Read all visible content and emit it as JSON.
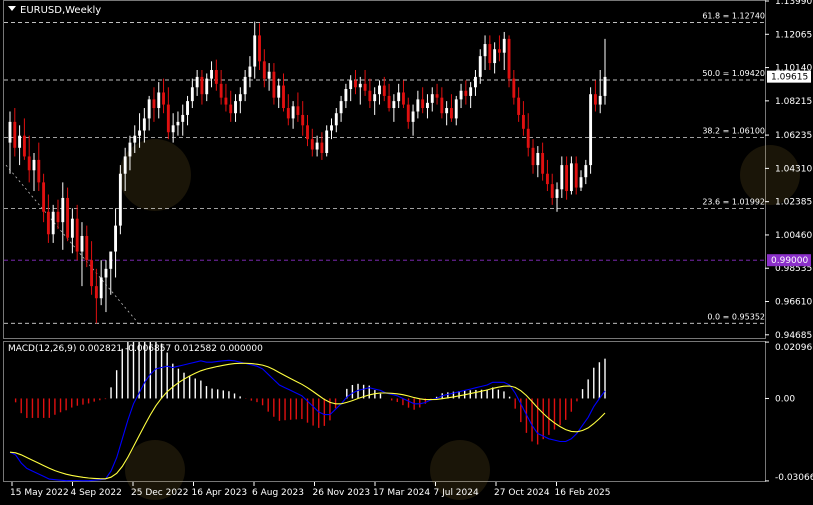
{
  "header": {
    "symbol_label": "EURUSD,Weekly",
    "macd_label": "MACD(12,26,9) 0.002821 -0.006857 0.012582 0.000000"
  },
  "colors": {
    "background": "#000000",
    "bull_candle": "#ffffff",
    "bear_candle": "#e01010",
    "fib_line": "#ffffff",
    "parity_line": "#8b2fc9",
    "macd_line": "#0000ff",
    "signal_line": "#ffff40",
    "hist_positive": "#ffffff",
    "hist_negative": "#e01010",
    "current_price_bg": "#ffffff",
    "parity_label_bg": "#8b2fc9",
    "axis_text": "#ffffff"
  },
  "chart_data": [
    {
      "type": "candlestick",
      "title": "EURUSD,Weekly",
      "ylim": [
        0.945,
        1.1399
      ],
      "y_ticks": [
        "1.13990",
        "1.12065",
        "1.10140",
        "1.08215",
        "1.06235",
        "1.04310",
        "1.02385",
        "1.00460",
        "0.98535",
        "0.96610",
        "0.94685"
      ],
      "x_ticks": [
        "15 May 2022",
        "4 Sep 2022",
        "25 Dec 2022",
        "16 Apr 2023",
        "6 Aug 2023",
        "26 Nov 2023",
        "17 Mar 2024",
        "7 Jul 2024",
        "27 Oct 2024",
        "16 Feb 2025"
      ],
      "current_price": "1.09615",
      "parity_label": "0.99000",
      "fib_levels": [
        {
          "label": "61.8 = 1.12740",
          "value": 1.1274
        },
        {
          "label": "50.0 = 1.09420",
          "value": 1.0942
        },
        {
          "label": "38.2 = 1.06100",
          "value": 1.061
        },
        {
          "label": "23.6 = 1.01992",
          "value": 1.01992
        },
        {
          "label": "0.0 = 0.95352",
          "value": 0.95352
        }
      ],
      "swing_line": {
        "from": 1.045,
        "to": 0.9535
      },
      "candles": [
        [
          1.058,
          1.076,
          1.04,
          1.07
        ],
        [
          1.07,
          1.078,
          1.05,
          1.055
        ],
        [
          1.055,
          1.068,
          1.045,
          1.062
        ],
        [
          1.062,
          1.072,
          1.048,
          1.05
        ],
        [
          1.05,
          1.062,
          1.035,
          1.042
        ],
        [
          1.042,
          1.052,
          1.03,
          1.048
        ],
        [
          1.048,
          1.058,
          1.03,
          1.035
        ],
        [
          1.035,
          1.04,
          1.012,
          1.018
        ],
        [
          1.018,
          1.028,
          1.0,
          1.005
        ],
        [
          1.005,
          1.022,
          1.0,
          1.018
        ],
        [
          1.018,
          1.025,
          1.008,
          1.012
        ],
        [
          1.012,
          1.035,
          0.996,
          1.026
        ],
        [
          1.026,
          1.032,
          1.001,
          1.003
        ],
        [
          1.003,
          1.02,
          0.994,
          1.014
        ],
        [
          1.014,
          1.022,
          0.99,
          0.995
        ],
        [
          0.995,
          1.012,
          0.975,
          1.004
        ],
        [
          1.004,
          1.01,
          0.986,
          0.99
        ],
        [
          0.99,
          1.001,
          0.97,
          0.975
        ],
        [
          0.975,
          0.985,
          0.9535,
          0.968
        ],
        [
          0.968,
          0.99,
          0.964,
          0.98
        ],
        [
          0.98,
          0.99,
          0.96,
          0.985
        ],
        [
          0.985,
          0.995,
          0.97,
          0.995
        ],
        [
          0.995,
          1.02,
          0.98,
          1.01
        ],
        [
          1.01,
          1.045,
          1.005,
          1.04
        ],
        [
          1.04,
          1.055,
          1.03,
          1.05
        ],
        [
          1.05,
          1.062,
          1.042,
          1.058
        ],
        [
          1.058,
          1.068,
          1.052,
          1.062
        ],
        [
          1.062,
          1.075,
          1.055,
          1.065
        ],
        [
          1.065,
          1.078,
          1.058,
          1.072
        ],
        [
          1.072,
          1.085,
          1.065,
          1.083
        ],
        [
          1.083,
          1.09,
          1.07,
          1.078
        ],
        [
          1.078,
          1.093,
          1.072,
          1.087
        ],
        [
          1.087,
          1.095,
          1.075,
          1.08
        ],
        [
          1.08,
          1.09,
          1.06,
          1.064
        ],
        [
          1.064,
          1.075,
          1.058,
          1.068
        ],
        [
          1.068,
          1.076,
          1.062,
          1.07
        ],
        [
          1.07,
          1.08,
          1.062,
          1.074
        ],
        [
          1.074,
          1.085,
          1.068,
          1.082
        ],
        [
          1.082,
          1.095,
          1.078,
          1.09
        ],
        [
          1.09,
          1.1,
          1.085,
          1.096
        ],
        [
          1.096,
          1.1,
          1.08,
          1.086
        ],
        [
          1.086,
          1.098,
          1.082,
          1.095
        ],
        [
          1.095,
          1.105,
          1.09,
          1.1
        ],
        [
          1.1,
          1.106,
          1.088,
          1.092
        ],
        [
          1.092,
          1.1,
          1.08,
          1.084
        ],
        [
          1.084,
          1.092,
          1.076,
          1.08
        ],
        [
          1.08,
          1.088,
          1.07,
          1.075
        ],
        [
          1.075,
          1.086,
          1.07,
          1.082
        ],
        [
          1.082,
          1.09,
          1.075,
          1.086
        ],
        [
          1.086,
          1.1,
          1.082,
          1.096
        ],
        [
          1.096,
          1.108,
          1.09,
          1.102
        ],
        [
          1.102,
          1.128,
          1.095,
          1.12
        ],
        [
          1.12,
          1.127,
          1.1,
          1.105
        ],
        [
          1.105,
          1.112,
          1.09,
          1.095
        ],
        [
          1.095,
          1.104,
          1.088,
          1.099
        ],
        [
          1.099,
          1.104,
          1.08,
          1.084
        ],
        [
          1.084,
          1.095,
          1.078,
          1.091
        ],
        [
          1.091,
          1.098,
          1.076,
          1.078
        ],
        [
          1.078,
          1.086,
          1.068,
          1.072
        ],
        [
          1.072,
          1.082,
          1.066,
          1.079
        ],
        [
          1.079,
          1.087,
          1.07,
          1.074
        ],
        [
          1.074,
          1.082,
          1.062,
          1.068
        ],
        [
          1.068,
          1.074,
          1.056,
          1.06
        ],
        [
          1.06,
          1.066,
          1.05,
          1.054
        ],
        [
          1.054,
          1.062,
          1.05,
          1.058
        ],
        [
          1.058,
          1.064,
          1.048,
          1.052
        ],
        [
          1.052,
          1.068,
          1.05,
          1.065
        ],
        [
          1.065,
          1.072,
          1.06,
          1.068
        ],
        [
          1.068,
          1.078,
          1.064,
          1.075
        ],
        [
          1.075,
          1.085,
          1.07,
          1.082
        ],
        [
          1.082,
          1.092,
          1.078,
          1.089
        ],
        [
          1.089,
          1.097,
          1.082,
          1.094
        ],
        [
          1.094,
          1.1,
          1.086,
          1.09
        ],
        [
          1.09,
          1.096,
          1.08,
          1.092
        ],
        [
          1.092,
          1.1,
          1.085,
          1.088
        ],
        [
          1.088,
          1.095,
          1.078,
          1.082
        ],
        [
          1.082,
          1.09,
          1.074,
          1.086
        ],
        [
          1.086,
          1.094,
          1.08,
          1.091
        ],
        [
          1.091,
          1.096,
          1.082,
          1.085
        ],
        [
          1.085,
          1.092,
          1.076,
          1.078
        ],
        [
          1.078,
          1.086,
          1.07,
          1.082
        ],
        [
          1.082,
          1.092,
          1.078,
          1.087
        ],
        [
          1.087,
          1.094,
          1.078,
          1.08
        ],
        [
          1.08,
          1.084,
          1.066,
          1.07
        ],
        [
          1.07,
          1.08,
          1.062,
          1.076
        ],
        [
          1.076,
          1.088,
          1.072,
          1.083
        ],
        [
          1.083,
          1.09,
          1.075,
          1.078
        ],
        [
          1.078,
          1.086,
          1.072,
          1.081
        ],
        [
          1.081,
          1.09,
          1.076,
          1.086
        ],
        [
          1.086,
          1.092,
          1.08,
          1.084
        ],
        [
          1.084,
          1.09,
          1.072,
          1.075
        ],
        [
          1.075,
          1.082,
          1.068,
          1.078
        ],
        [
          1.078,
          1.086,
          1.07,
          1.072
        ],
        [
          1.072,
          1.085,
          1.068,
          1.083
        ],
        [
          1.083,
          1.092,
          1.078,
          1.088
        ],
        [
          1.088,
          1.094,
          1.08,
          1.085
        ],
        [
          1.085,
          1.093,
          1.078,
          1.09
        ],
        [
          1.09,
          1.1,
          1.085,
          1.096
        ],
        [
          1.096,
          1.112,
          1.092,
          1.108
        ],
        [
          1.108,
          1.12,
          1.1,
          1.115
        ],
        [
          1.115,
          1.12,
          1.1,
          1.104
        ],
        [
          1.104,
          1.116,
          1.098,
          1.112
        ],
        [
          1.112,
          1.12,
          1.105,
          1.11
        ],
        [
          1.11,
          1.122,
          1.1,
          1.118
        ],
        [
          1.118,
          1.12,
          1.09,
          1.095
        ],
        [
          1.095,
          1.1,
          1.08,
          1.084
        ],
        [
          1.084,
          1.09,
          1.07,
          1.074
        ],
        [
          1.074,
          1.082,
          1.062,
          1.066
        ],
        [
          1.066,
          1.075,
          1.05,
          1.055
        ],
        [
          1.055,
          1.06,
          1.04,
          1.045
        ],
        [
          1.045,
          1.056,
          1.038,
          1.052
        ],
        [
          1.052,
          1.058,
          1.036,
          1.04
        ],
        [
          1.04,
          1.048,
          1.03,
          1.034
        ],
        [
          1.034,
          1.04,
          1.022,
          1.026
        ],
        [
          1.026,
          1.035,
          1.018,
          1.031
        ],
        [
          1.031,
          1.05,
          1.026,
          1.045
        ],
        [
          1.045,
          1.05,
          1.025,
          1.03
        ],
        [
          1.03,
          1.05,
          1.028,
          1.046
        ],
        [
          1.046,
          1.05,
          1.028,
          1.032
        ],
        [
          1.032,
          1.042,
          1.03,
          1.038
        ],
        [
          1.038,
          1.048,
          1.034,
          1.045
        ],
        [
          1.045,
          1.09,
          1.04,
          1.086
        ],
        [
          1.086,
          1.094,
          1.076,
          1.08
        ],
        [
          1.08,
          1.1,
          1.075,
          1.085
        ],
        [
          1.085,
          1.118,
          1.08,
          1.096
        ]
      ],
      "macd": {
        "label": "MACD(12,26,9) 0.002821 -0.006857 0.012582 0.000000",
        "ylim": [
          -0.0307,
          0.021
        ],
        "y_ticks": [
          "0.020967",
          "0.00",
          "-0.030668"
        ],
        "main": [
          -0.02,
          -0.021,
          -0.024,
          -0.026,
          -0.027,
          -0.028,
          -0.029,
          -0.03,
          -0.0302,
          -0.0304,
          -0.0306,
          -0.0305,
          -0.0305,
          -0.0306,
          -0.0306,
          -0.0304,
          -0.0302,
          -0.03,
          -0.027,
          -0.022,
          -0.015,
          -0.008,
          -0.002,
          0.002,
          0.006,
          0.009,
          0.011,
          0.0115,
          0.012,
          0.0115,
          0.012,
          0.0125,
          0.013,
          0.0135,
          0.014,
          0.0135,
          0.0135,
          0.0138,
          0.014,
          0.0142,
          0.014,
          0.0135,
          0.013,
          0.0125,
          0.012,
          0.011,
          0.009,
          0.007,
          0.005,
          0.004,
          0.003,
          0.002,
          0.001,
          -0.001,
          -0.003,
          -0.005,
          -0.006,
          -0.006,
          -0.004,
          -0.002,
          0.0005,
          0.002,
          0.003,
          0.0035,
          0.004,
          0.0035,
          0.003,
          0.002,
          0.0015,
          0.001,
          0.0,
          -0.001,
          -0.002,
          -0.002,
          -0.0015,
          -0.0005,
          0.0,
          0.001,
          0.0015,
          0.002,
          0.0025,
          0.003,
          0.0035,
          0.004,
          0.0045,
          0.005,
          0.006,
          0.006,
          0.006,
          0.005,
          0.002,
          -0.002,
          -0.006,
          -0.01,
          -0.013,
          -0.014,
          -0.015,
          -0.0155,
          -0.016,
          -0.016,
          -0.015,
          -0.013,
          -0.01,
          -0.007,
          -0.003,
          0.0,
          0.0028
        ]
      }
    }
  ]
}
